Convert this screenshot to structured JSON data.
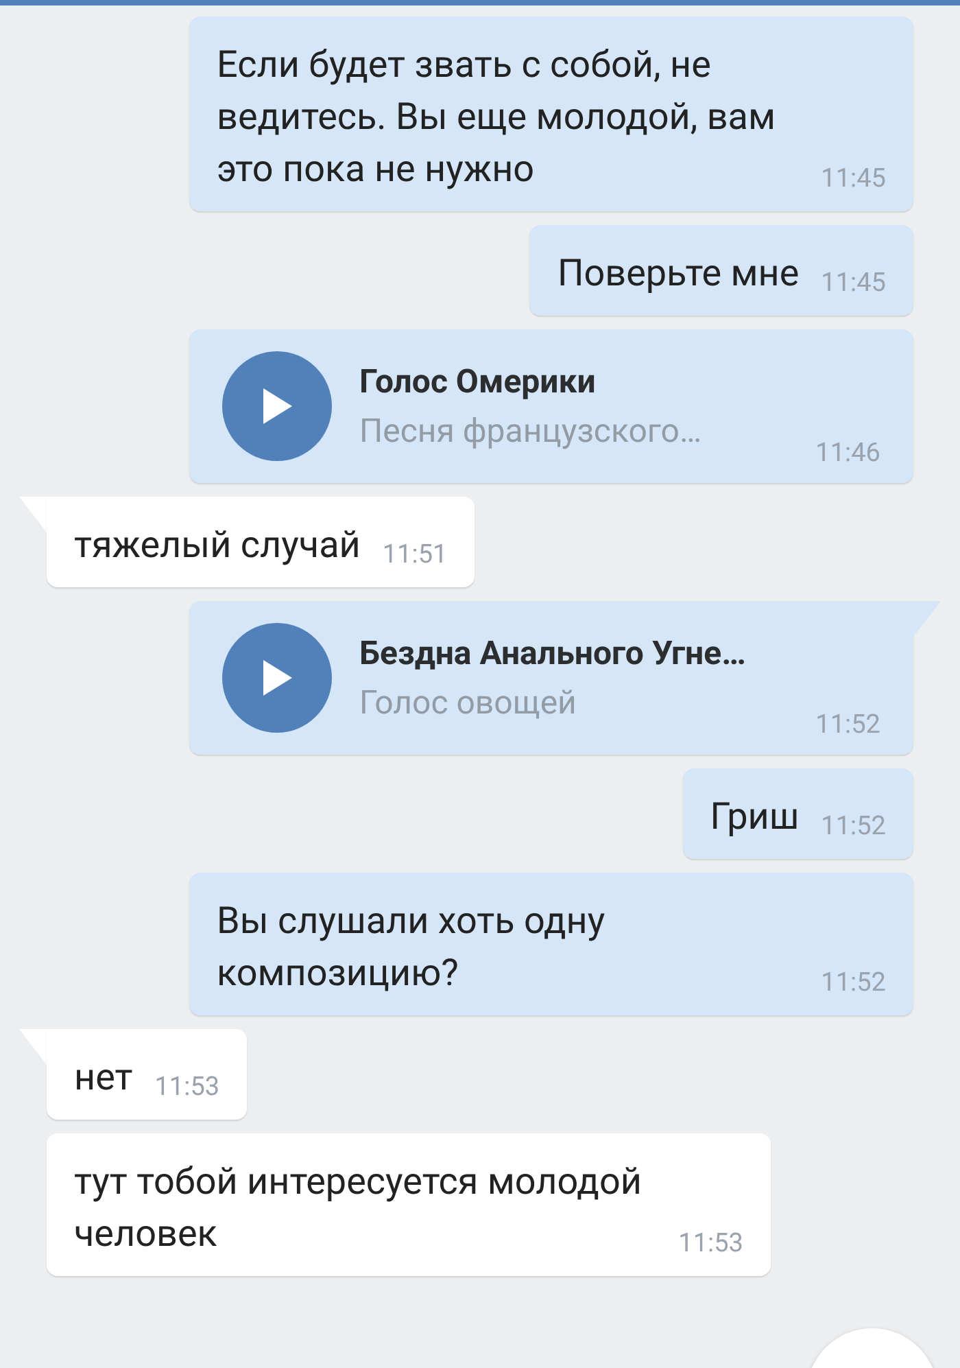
{
  "messages": [
    {
      "kind": "text",
      "outgoing": true,
      "tail": false,
      "text": "Если будет звать с собой, не ведитесь. Вы еще молодой, вам это пока не нужно",
      "time": "11:45"
    },
    {
      "kind": "text",
      "outgoing": true,
      "tail": false,
      "text": "Поверьте мне",
      "time": "11:45"
    },
    {
      "kind": "audio",
      "outgoing": true,
      "tail": false,
      "title": "Голос Омерики",
      "artist": "Песня французского…",
      "time": "11:46"
    },
    {
      "kind": "text",
      "outgoing": false,
      "tail": true,
      "text": "тяжелый случай",
      "time": "11:51"
    },
    {
      "kind": "audio",
      "outgoing": true,
      "tail": true,
      "title": "Бездна Анального Угне…",
      "artist": "Голос овощей",
      "time": "11:52"
    },
    {
      "kind": "text",
      "outgoing": true,
      "tail": false,
      "text": "Гриш",
      "time": "11:52"
    },
    {
      "kind": "text",
      "outgoing": true,
      "tail": false,
      "text": "Вы слушали хоть одну композицию?",
      "time": "11:52"
    },
    {
      "kind": "text",
      "outgoing": false,
      "tail": true,
      "text": "нет",
      "time": "11:53"
    },
    {
      "kind": "text",
      "outgoing": false,
      "tail": false,
      "text": "тут тобой интересуется молодой человек",
      "time": "11:53"
    }
  ]
}
